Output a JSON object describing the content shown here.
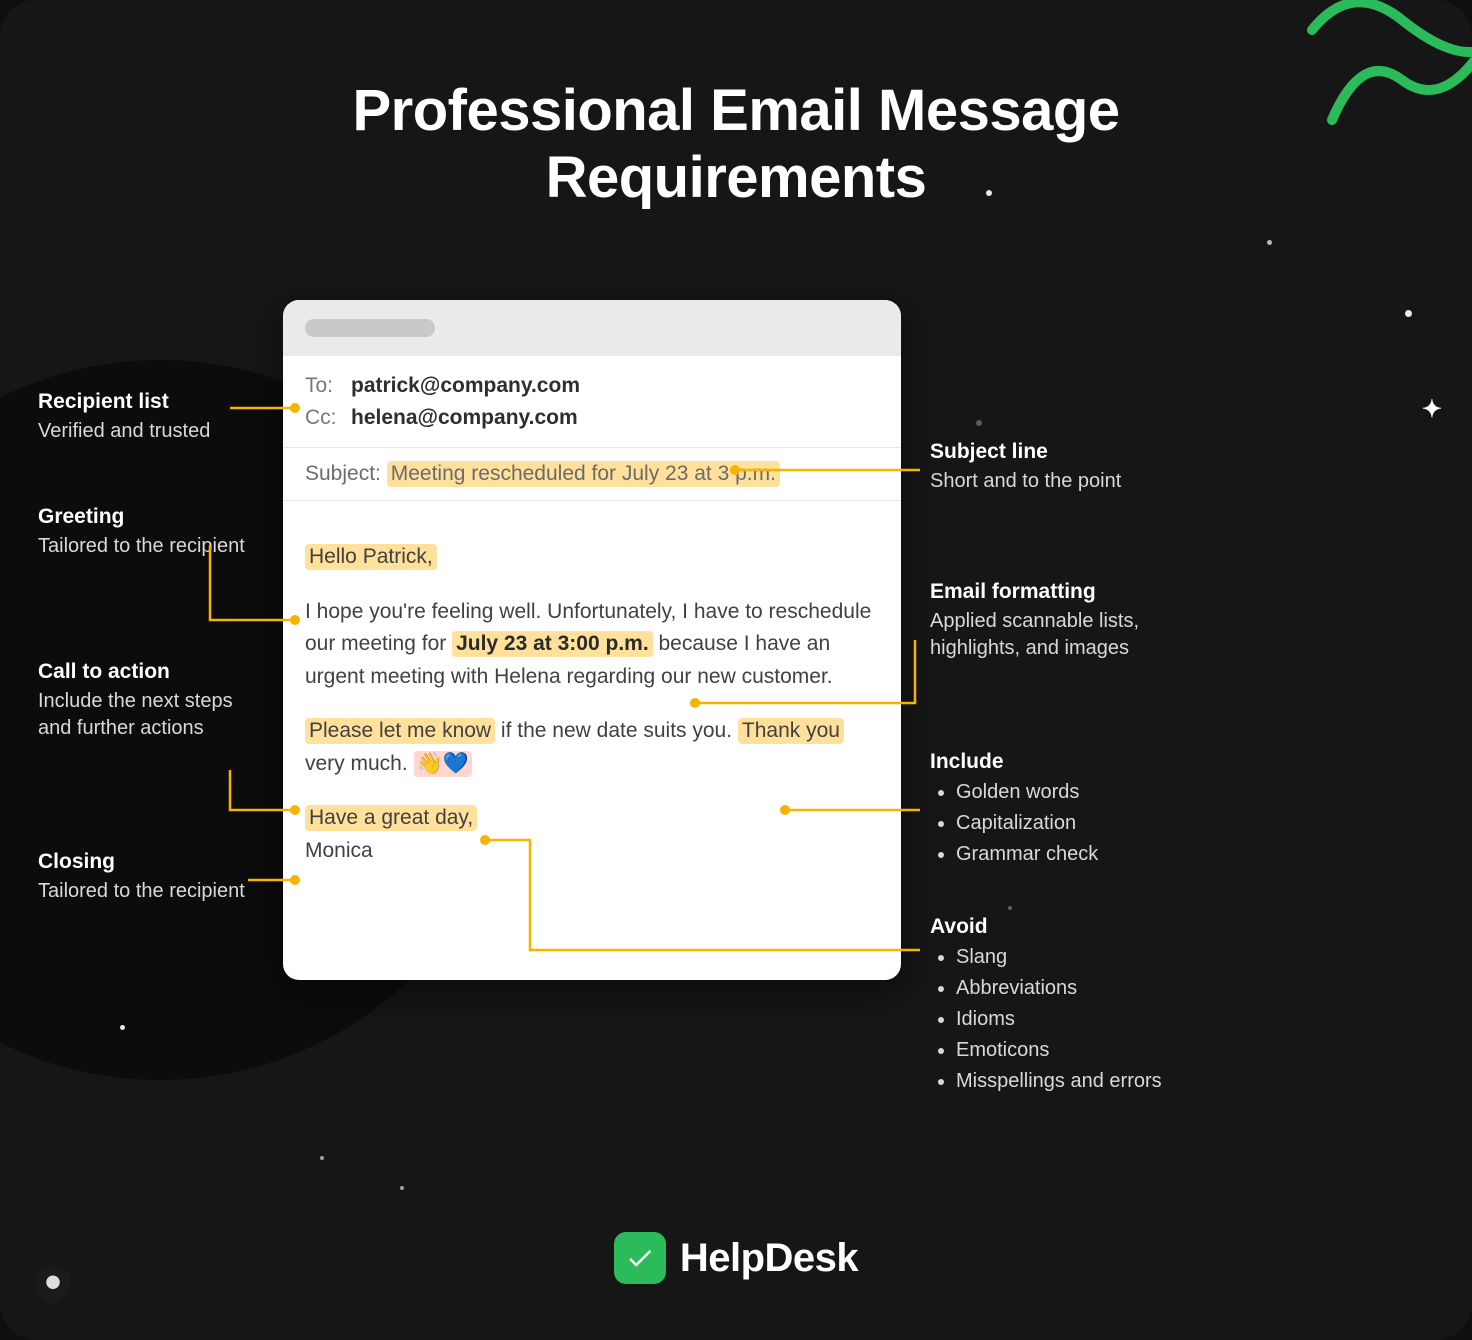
{
  "title_line1": "Professional Email Message",
  "title_line2": "Requirements",
  "email": {
    "to_label": "To:",
    "to_value": "patrick@company.com",
    "cc_label": "Cc:",
    "cc_value": "helena@company.com",
    "subject_label": "Subject:",
    "subject_value": "Meeting rescheduled for July 23 at 3 p.m.",
    "greeting": "Hello Patrick,",
    "body_pre": "I hope you're feeling well. Unfortunately, I have to reschedule our meeting for ",
    "body_date": "July 23 at 3:00 p.m.",
    "body_post": " because I have an urgent meeting with Helena regarding our new customer.",
    "cta_hl": "Please let me know",
    "cta_rest": " if the new date suits you. ",
    "thank_you": "Thank you",
    "very_much": " very much. ",
    "emoji": "👋💙",
    "closing_hl": "Have a great day,",
    "closing_name": "Monica"
  },
  "left": {
    "recipient": {
      "title": "Recipient list",
      "desc": "Verified and trusted"
    },
    "greeting": {
      "title": "Greeting",
      "desc": "Tailored to the recipient"
    },
    "cta": {
      "title": "Call to action",
      "desc": "Include the next steps and further actions"
    },
    "closing": {
      "title": "Closing",
      "desc": "Tailored to the recipient"
    }
  },
  "right": {
    "subject": {
      "title": "Subject line",
      "desc": "Short and to the point"
    },
    "format": {
      "title": "Email formatting",
      "desc": "Applied scannable lists, highlights, and images"
    },
    "include": {
      "title": "Include",
      "items": [
        "Golden words",
        "Capitalization",
        "Grammar check"
      ]
    },
    "avoid": {
      "title": "Avoid",
      "items": [
        "Slang",
        "Abbreviations",
        "Idioms",
        "Emoticons",
        "Misspellings and errors"
      ]
    }
  },
  "brand": "HelpDesk"
}
